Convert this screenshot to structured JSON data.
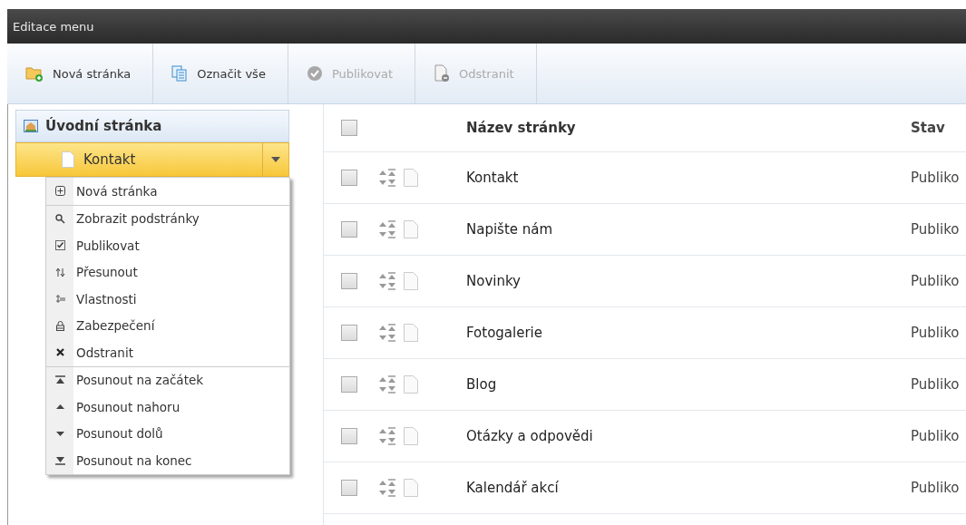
{
  "window": {
    "title": "Editace menu"
  },
  "toolbar": [
    {
      "label": "Nová stránka",
      "kind": "new",
      "disabled": false
    },
    {
      "label": "Označit vše",
      "kind": "selectall",
      "disabled": false
    },
    {
      "label": "Publikovat",
      "kind": "publish",
      "disabled": true
    },
    {
      "label": "Odstranit",
      "kind": "delete",
      "disabled": true
    }
  ],
  "tree": {
    "root": "Úvodní stránka",
    "selected_item": {
      "label": "Kontakt",
      "selected": true
    }
  },
  "context_menu": [
    [
      {
        "label": "Nová stránka",
        "kind": "new"
      }
    ],
    [
      {
        "label": "Zobrazit podstránky",
        "kind": "search"
      },
      {
        "label": "Publikovat",
        "kind": "check"
      },
      {
        "label": "Přesunout",
        "kind": "move"
      },
      {
        "label": "Vlastnosti",
        "kind": "props"
      },
      {
        "label": "Zabezpečení",
        "kind": "lock"
      },
      {
        "label": "Odstranit",
        "kind": "delete"
      }
    ],
    [
      {
        "label": "Posunout na začátek",
        "kind": "top"
      },
      {
        "label": "Posunout nahoru",
        "kind": "up"
      },
      {
        "label": "Posunout dolů",
        "kind": "down"
      },
      {
        "label": "Posunout na konec",
        "kind": "bottom"
      }
    ]
  ],
  "table": {
    "header_checked": false,
    "columns": [
      "Název stránky",
      "Stav"
    ],
    "rows": [
      {
        "name": "Kontakt",
        "status": "Publiko",
        "checked": false
      },
      {
        "name": "Napište nám",
        "status": "Publiko",
        "checked": false
      },
      {
        "name": "Novinky",
        "status": "Publiko",
        "checked": false
      },
      {
        "name": "Fotogalerie",
        "status": "Publiko",
        "checked": false
      },
      {
        "name": "Blog",
        "status": "Publiko",
        "checked": false
      },
      {
        "name": "Otázky a odpovědi",
        "status": "Publiko",
        "checked": false
      },
      {
        "name": "Kalendář akcí",
        "status": "Publiko",
        "checked": false
      }
    ]
  }
}
